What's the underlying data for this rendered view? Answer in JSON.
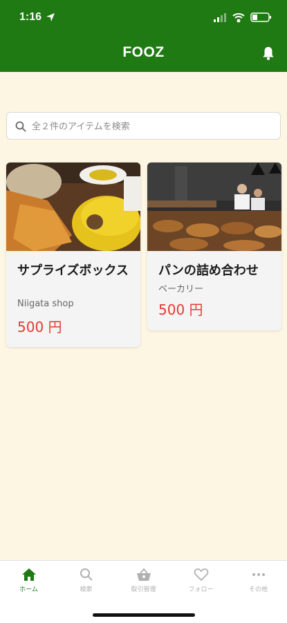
{
  "status_bar": {
    "time": "1:16"
  },
  "header": {
    "title": "FOOZ"
  },
  "search": {
    "placeholder": "全２件のアイテムを検索"
  },
  "items": [
    {
      "name": "サプライズボックス",
      "shop": "Niigata shop",
      "price": "500 円"
    },
    {
      "name": "パンの詰め合わせ",
      "shop": "ベーカリー",
      "price": "500 円"
    }
  ],
  "tabs": [
    {
      "label": "ホーム",
      "icon": "home-icon",
      "active": true
    },
    {
      "label": "検索",
      "icon": "search-icon",
      "active": false
    },
    {
      "label": "取引管理",
      "icon": "basket-icon",
      "active": false
    },
    {
      "label": "フォロー",
      "icon": "heart-icon",
      "active": false
    },
    {
      "label": "その他",
      "icon": "more-icon",
      "active": false
    }
  ],
  "colors": {
    "brand": "#1f7a14",
    "background": "#fdf6e3",
    "price": "#e53935"
  }
}
